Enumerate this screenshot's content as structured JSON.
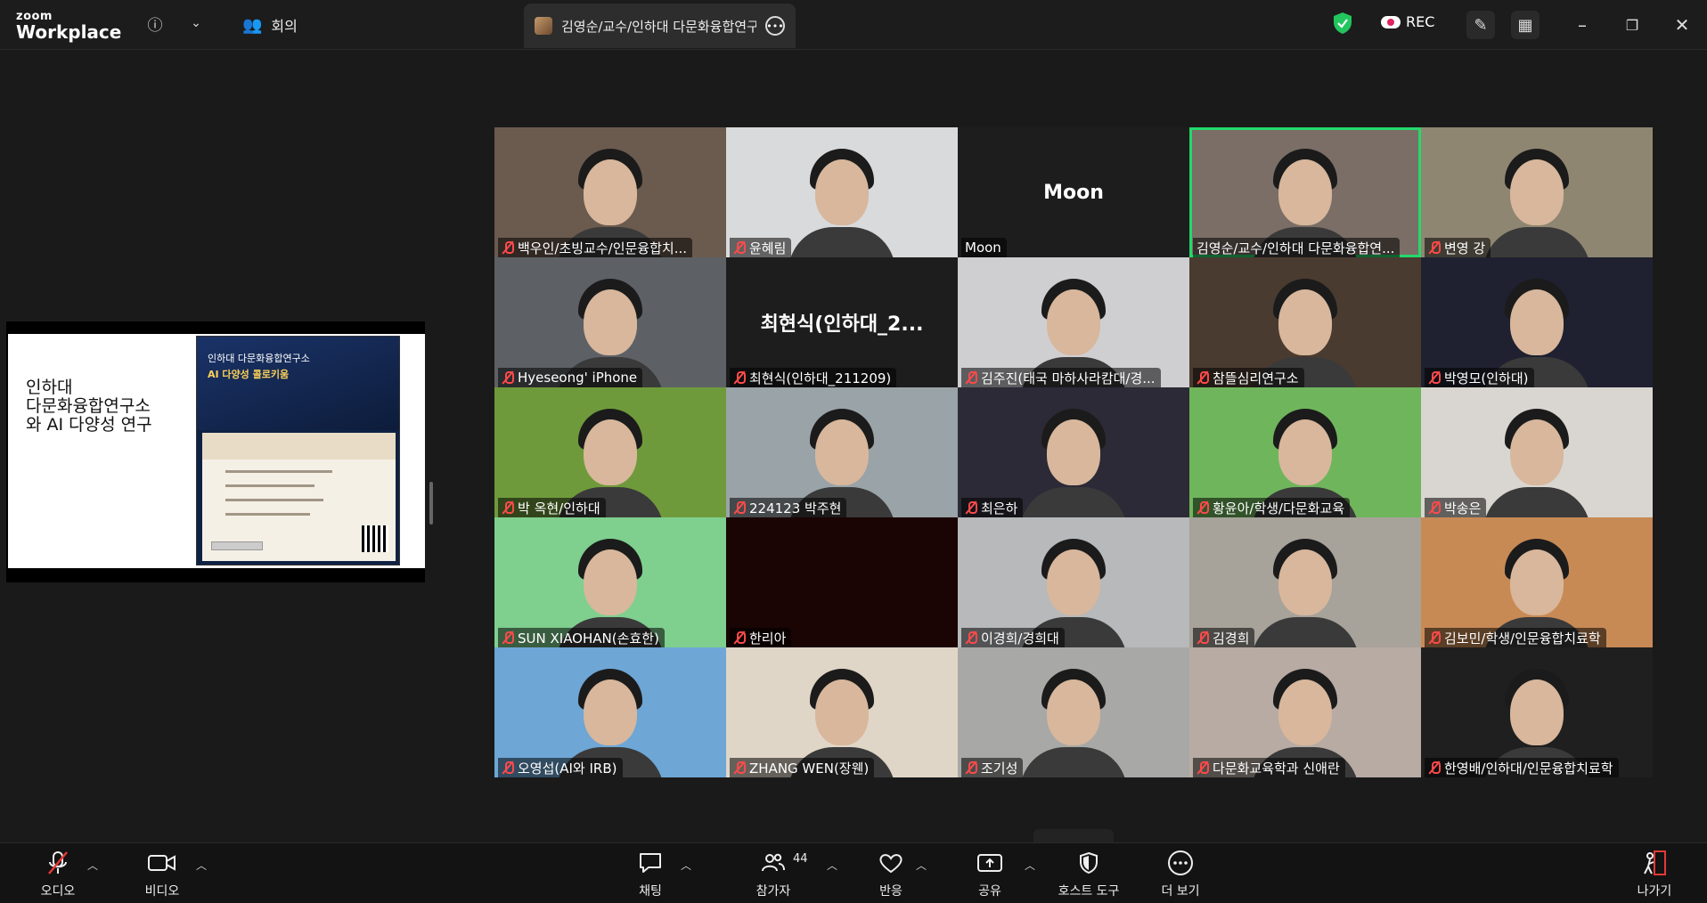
{
  "app": {
    "brand_top": "zoom",
    "brand_bottom": "Workplace"
  },
  "titlebar": {
    "meeting_label": "회의",
    "active_tab": "김영순/교수/인하대 다문화융합연구소",
    "rec_label": "REC",
    "colors": {
      "shield": "#22c55e",
      "accent_active": "#23d96b"
    }
  },
  "slide": {
    "title_lines": [
      "인하대",
      "다문화융합연구소",
      "와 AI 다양성 연구"
    ],
    "poster_title": "인하대 다문화융합연구소",
    "poster_subtitle": "AI 다양성 콜로키움"
  },
  "participants": [
    {
      "name": "백우인/초빙교수/인문융합치...",
      "muted": true,
      "bg": "#6b5a4e"
    },
    {
      "name": "윤혜림",
      "muted": true,
      "bg": "#d9dadb"
    },
    {
      "name": "Moon",
      "muted": false,
      "bg": "#1d1d1d",
      "center": "Moon"
    },
    {
      "name": "김영순/교수/인하대 다문화융합연...",
      "muted": false,
      "bg": "#7a6e66",
      "active": true
    },
    {
      "name": "변영 강",
      "muted": true,
      "bg": "#8f8672"
    },
    {
      "name": "Hyeseong' iPhone",
      "muted": true,
      "bg": "#5d6165"
    },
    {
      "name": "최현식(인하대_211209)",
      "muted": true,
      "bg": "#1d1d1d",
      "center": "최현식(인하대_2..."
    },
    {
      "name": "김주진(태국 마하사라캄대/경...",
      "muted": true,
      "bg": "#cfcfd2"
    },
    {
      "name": "참뜰심리연구소",
      "muted": true,
      "bg": "#4a3b30"
    },
    {
      "name": "박영모(인하대)",
      "muted": true,
      "bg": "#1f2030"
    },
    {
      "name": "박 옥현/인하대",
      "muted": true,
      "bg": "#6f9a3b"
    },
    {
      "name": "224123 박주현",
      "muted": true,
      "bg": "#9aa3a7"
    },
    {
      "name": "최은하",
      "muted": true,
      "bg": "#2b2a36"
    },
    {
      "name": "황윤아/학생/다문화교육",
      "muted": true,
      "bg": "#6fb55c"
    },
    {
      "name": "박송은",
      "muted": true,
      "bg": "#d9d6d1"
    },
    {
      "name": "SUN XIAOHAN(손효한)",
      "muted": true,
      "bg": "#7fcf8f"
    },
    {
      "name": "한리아",
      "muted": true,
      "bg": "#1a0404"
    },
    {
      "name": "이경희/경희대",
      "muted": true,
      "bg": "#b7b9bb"
    },
    {
      "name": "김경희",
      "muted": true,
      "bg": "#a7a29a"
    },
    {
      "name": "김보민/학생/인문융합치료학",
      "muted": true,
      "bg": "#c88a55"
    },
    {
      "name": "오영섭(AI와 IRB)",
      "muted": true,
      "bg": "#6ea6d6"
    },
    {
      "name": "ZHANG WEN(장웬)",
      "muted": true,
      "bg": "#e0d6c8"
    },
    {
      "name": "조기성",
      "muted": true,
      "bg": "#a8a8a6"
    },
    {
      "name": "다문화교육학과 신애란",
      "muted": true,
      "bg": "#b7aba3"
    },
    {
      "name": "한영배/인하대/인문융합치료학",
      "muted": true,
      "bg": "#1f1f1f"
    }
  ],
  "toolbar": {
    "audio": "오디오",
    "video": "비디오",
    "chat": "채팅",
    "participants": "참가자",
    "participants_count": "44",
    "reactions": "반응",
    "share": "공유",
    "host_tools": "호스트 도구",
    "more": "더 보기",
    "leave": "나가기"
  }
}
